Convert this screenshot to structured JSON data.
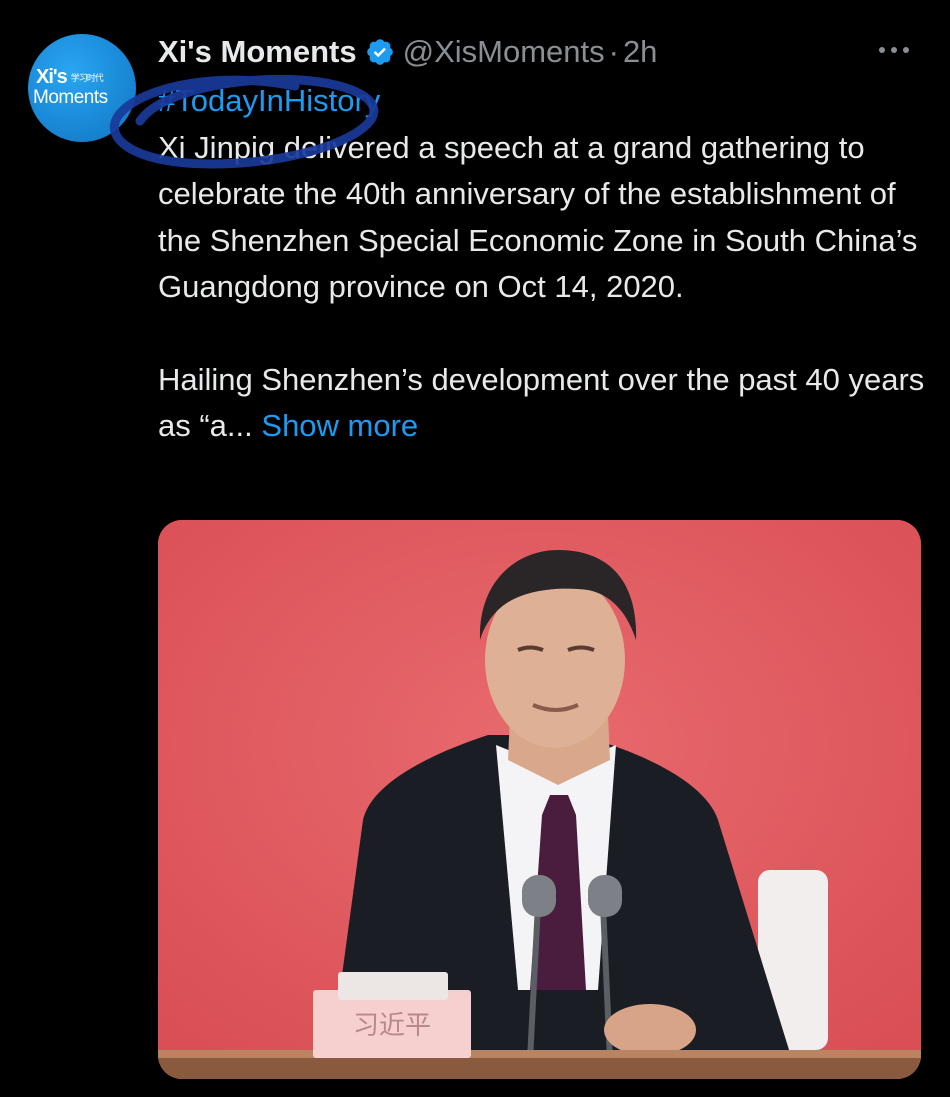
{
  "tweet": {
    "avatar": {
      "brand_line1": "Xi's",
      "brand_cn": "学习时代",
      "brand_line2": "Moments"
    },
    "display_name": "Xi's Moments",
    "handle": "@XisMoments",
    "separator": "·",
    "timestamp": "2h",
    "hashtag": "#TodayInHistory",
    "paragraph1": "Xi Jinpig delivered a speech at a grand gathering to celebrate the 40th anniversary of the establishment of the Shenzhen Special Economic Zone in South China’s Guangdong province on Oct 14, 2020.",
    "paragraph2": "Hailing Shenzhen’s development over the past 40 years as “a...",
    "show_more": "Show more",
    "media": {
      "nameplate": "习近平"
    }
  },
  "colors": {
    "background": "#000000",
    "text": "#e7e9ea",
    "secondary_text": "#8b8f94",
    "link": "#1d9bf0",
    "avatar": "#1a8ad8",
    "photo_backdrop": "#e05a5e",
    "annotation": "#1a3a9a"
  },
  "icons": {
    "verified": "verified-badge-icon",
    "more": "more-options-icon"
  }
}
